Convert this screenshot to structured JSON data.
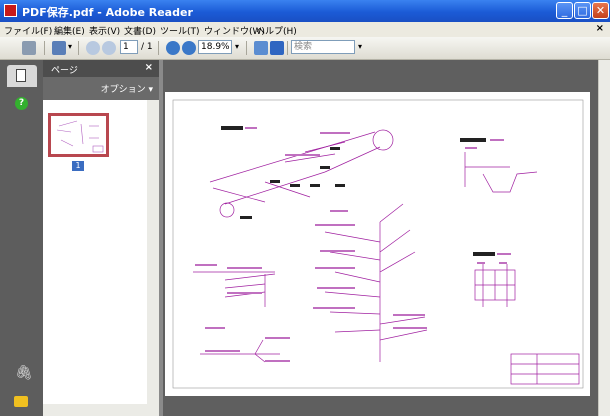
{
  "window": {
    "title": "PDF保存.pdf - Adobe Reader",
    "min_label": "_",
    "max_label": "□",
    "close_label": "✕"
  },
  "menu": {
    "items": [
      "ファイル(F)",
      "編集(E)",
      "表示(V)",
      "文書(D)",
      "ツール(T)",
      "ウィンドウ(W)",
      "ヘルプ(H)"
    ],
    "close_label": "×"
  },
  "toolbar": {
    "page_current": "1",
    "page_total": "/ 1",
    "zoom": "18.9%",
    "search_placeholder": "検索"
  },
  "pages_panel": {
    "title": "ページ",
    "close_label": "×",
    "options_label": "オプション ▾",
    "thumbnail_number": "1"
  },
  "nav": {
    "help_label": "?"
  },
  "colors": {
    "titlebar": "#1b5bd6",
    "drawing_line": "#a020a0",
    "thumb_border": "#b8474f"
  }
}
